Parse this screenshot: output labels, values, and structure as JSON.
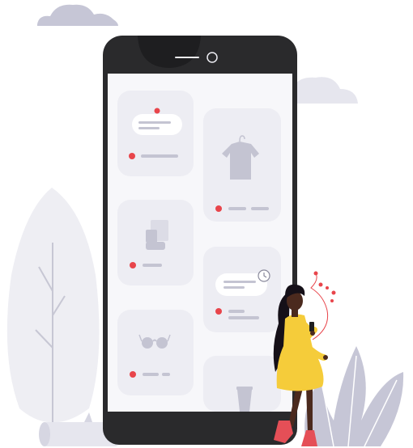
{
  "illustration": {
    "subject": "shopping-app-phone-with-woman",
    "colors": {
      "accent": "#E8454B",
      "card": "#EDEDF3",
      "screen": "#F7F7FA",
      "phone_frame": "#2A2A2C",
      "cloud": "#C6C6D6",
      "foliage": "#E6E6EE",
      "dress": "#F5CC3A",
      "shoes": "#E54F57",
      "skin": "#4B2A1E"
    },
    "cards": [
      {
        "icon": "message-bubble-icon",
        "column": "left",
        "row": 1
      },
      {
        "icon": "tshirt-on-hanger-icon",
        "column": "right",
        "row": 1
      },
      {
        "icon": "boot-icon",
        "column": "left",
        "row": 2
      },
      {
        "icon": "message-bubble-clock-icon",
        "column": "right",
        "row": 2
      },
      {
        "icon": "sunglasses-icon",
        "column": "left",
        "row": 3
      },
      {
        "icon": "cup-icon",
        "column": "right",
        "row": 3
      }
    ]
  }
}
